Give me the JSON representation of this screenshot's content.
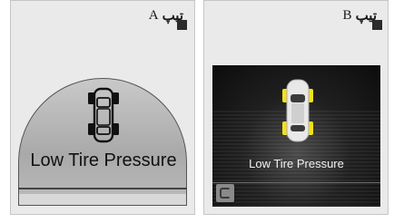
{
  "type_a": {
    "label_word": "تیپ",
    "label_letter": "A",
    "message": "Low Tire Pressure"
  },
  "type_b": {
    "label_word": "تیپ",
    "label_letter": "B",
    "message": "Low Tire Pressure"
  },
  "colors": {
    "tire_warning": "#f2e21a",
    "dome_gray": "#b5b5b5",
    "screen_dark": "#111111"
  },
  "icons": {
    "title_marker": "black-square-icon",
    "car_topview": "car-topview-icon",
    "parking": "parking-icon"
  }
}
